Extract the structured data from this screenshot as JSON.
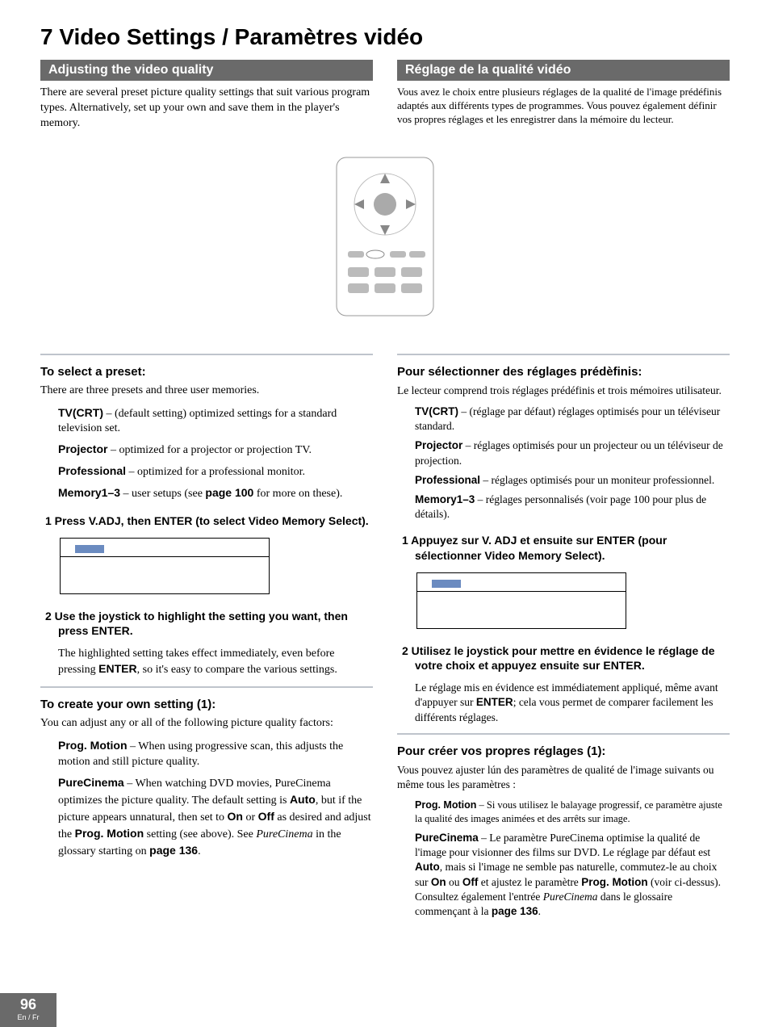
{
  "chapter": "7 Video Settings / Paramètres vidéo",
  "left": {
    "header": "Adjusting the video quality",
    "intro": "There are several preset picture quality settings that suit various program types. Alternatively, set up your own and save them in the player's memory.",
    "select_heading": "To select a preset:",
    "select_intro": "There are three presets and three user memories.",
    "defs": [
      {
        "term": "TV(CRT)",
        "desc": " – (default setting) optimized settings for a standard television set."
      },
      {
        "term": "Projector",
        "desc": " – optimized for a projector or projection TV."
      },
      {
        "term": "Professional",
        "desc": " – optimized for a professional monitor."
      },
      {
        "term": "Memory1–3",
        "desc_pre": " – user setups (see ",
        "desc_bold": "page 100",
        "desc_post": " for more on these)."
      }
    ],
    "step1": "1  Press V.ADJ, then ENTER (to select Video Memory Select).",
    "step2": "2  Use the joystick to highlight the setting you want, then press ENTER.",
    "step2_body_pre": "The highlighted setting takes effect immediately, even before pressing ",
    "step2_body_bold": "ENTER",
    "step2_body_post": ", so it's easy to compare the various settings.",
    "create_heading": "To create your own setting (1):",
    "create_intro": "You can adjust any or all of the following picture quality factors:",
    "create_defs": [
      {
        "term": "Prog. Motion",
        "desc": " – When using progressive scan, this adjusts the motion and still picture quality."
      }
    ],
    "pc_term": "PureCinema",
    "pc_1": " – When watching DVD movies, PureCinema optimizes the picture quality. The default setting is ",
    "pc_auto": "Auto",
    "pc_2": ", but if the picture appears unnatural, then set to ",
    "pc_on": "On",
    "pc_or": " or ",
    "pc_off": "Off",
    "pc_3": " as desired and adjust the ",
    "pc_pm": "Prog. Motion",
    "pc_4": " setting (see above). See ",
    "pc_it": "PureCinema",
    "pc_5": " in the glossary starting on ",
    "pc_pg": "page 136",
    "pc_6": "."
  },
  "right": {
    "header": "Réglage de la qualité vidéo",
    "intro": "Vous avez le choix entre plusieurs réglages de la qualité de l'image prédéfinis adaptés aux différents types de programmes.  Vous pouvez également définir vos propres réglages et les enregistrer dans la mémoire du lecteur.",
    "select_heading": "Pour sélectionner des réglages prédèfinis:",
    "select_intro": "Le lecteur comprend trois réglages prédéfinis et trois mémoires utilisateur.",
    "defs": [
      {
        "term": "TV(CRT)",
        "desc": " – (réglage par défaut) réglages optimisés pour un téléviseur standard."
      },
      {
        "term": "Projector",
        "desc": " – réglages optimisés pour un projecteur ou un téléviseur de projection."
      },
      {
        "term": "Professional",
        "desc": " – réglages optimisés pour un moniteur professionnel."
      },
      {
        "term": "Memory1–3",
        "desc": "  – réglages personnalisés (voir page 100 pour plus de détails)."
      }
    ],
    "step1": "1  Appuyez sur V. ADJ et ensuite sur ENTER (pour sélectionner Video Memory Select).",
    "step2": "2  Utilisez le joystick pour mettre en évidence le réglage de votre choix et appuyez ensuite sur ENTER.",
    "step2_body_pre": "Le réglage mis en évidence est immédiatement appliqué, même avant d'appuyer sur ",
    "step2_body_bold": "ENTER",
    "step2_body_post": "; cela vous permet de comparer facilement les différents réglages.",
    "create_heading": "Pour créer vos propres réglages (1):",
    "create_intro": "Vous pouvez ajuster lún des paramètres de qualité de l'image suivants ou même tous les paramètres :",
    "create_defs": [
      {
        "term": "Prog. Motion",
        "desc": " – Si vous utilisez le balayage progressif, ce paramètre ajuste la qualité des images animées et des arrêts sur image."
      }
    ],
    "pc_term": "PureCinema",
    "pc_1": " – Le paramètre PureCinema optimise la qualité de l'image pour visionner des films sur DVD.  Le réglage par défaut est ",
    "pc_auto": "Auto",
    "pc_2": ", mais si l'image ne semble pas naturelle, commutez-le au choix sur ",
    "pc_on": "On",
    "pc_or": " ou ",
    "pc_off": "Off",
    "pc_3": " et ajustez le paramètre ",
    "pc_pm": "Prog. Motion",
    "pc_4": " (voir ci-dessus).  Consultez également l'entrée ",
    "pc_it": "PureCinema",
    "pc_5": " dans le glossaire commençant à la ",
    "pc_pg": "page 136",
    "pc_6": "."
  },
  "footer": {
    "page": "96",
    "lang": "En / Fr"
  }
}
